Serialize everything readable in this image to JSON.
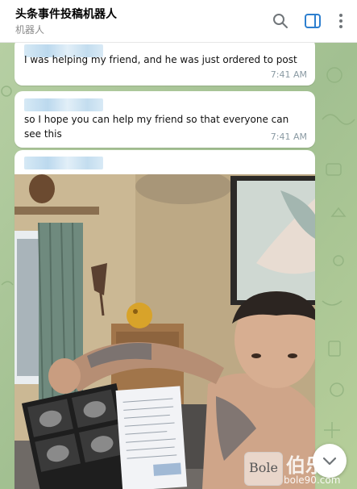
{
  "header": {
    "title": "头条事件投稿机器人",
    "subtitle": "机器人",
    "icons": [
      "search-icon",
      "sidebar-toggle-icon",
      "more-vertical-icon"
    ],
    "accent_color": "#2d7fcf"
  },
  "messages": [
    {
      "text": "I was helping my friend, and he was just ordered to post",
      "time": "7:41 AM",
      "sender_name_blurred": true
    },
    {
      "text": "so I hope you can help my friend so that everyone can see this",
      "time": "7:41 AM",
      "sender_name_blurred": true
    },
    {
      "sender_name_blurred": true,
      "attachment": "photo"
    }
  ],
  "watermark": {
    "logo": "Bole",
    "text": "伯乐",
    "url": "bole90.com"
  }
}
